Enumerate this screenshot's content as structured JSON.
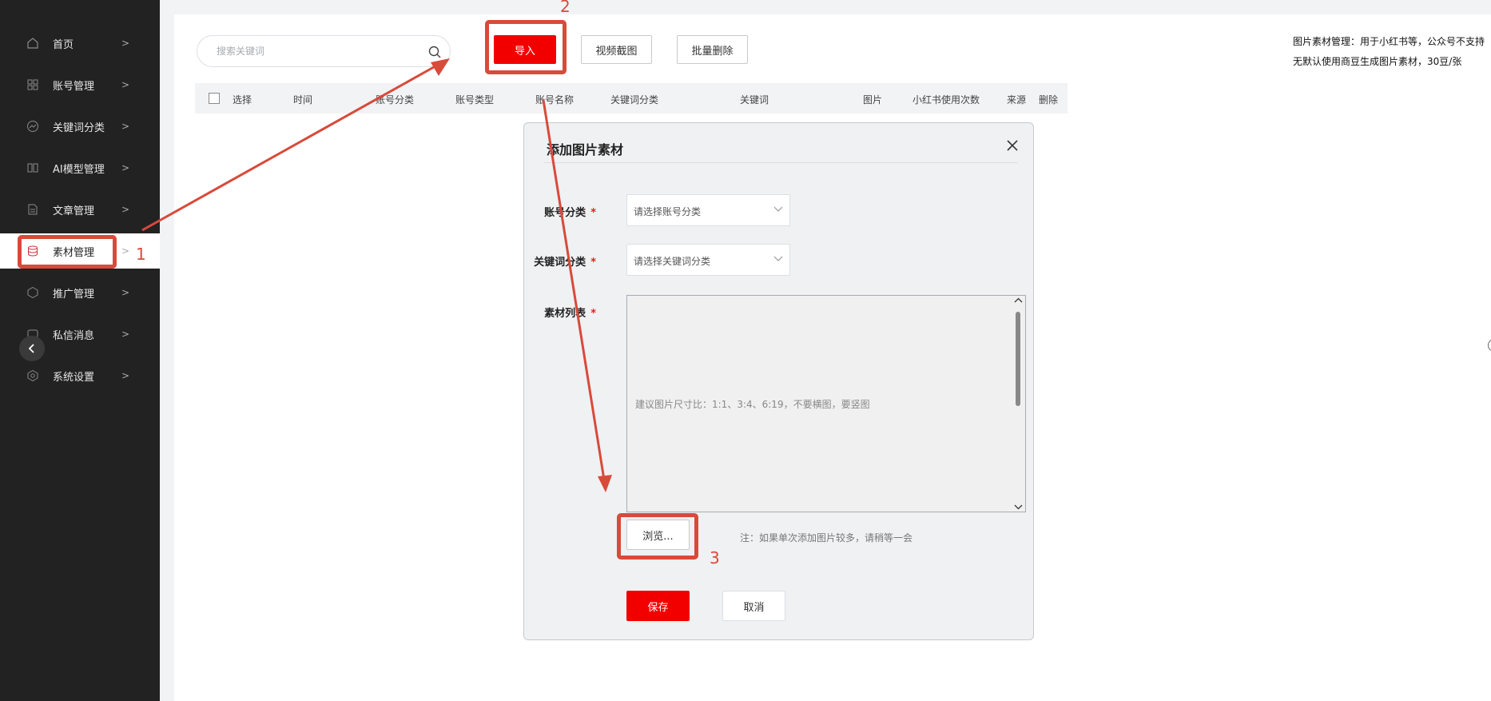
{
  "sidebar": {
    "items": [
      {
        "label": "首页",
        "icon": "home-icon"
      },
      {
        "label": "账号管理",
        "icon": "grid-icon"
      },
      {
        "label": "关键词分类",
        "icon": "trend-icon"
      },
      {
        "label": "AI模型管理",
        "icon": "book-icon"
      },
      {
        "label": "文章管理",
        "icon": "document-icon"
      },
      {
        "label": "素材管理",
        "icon": "database-icon",
        "active": true
      },
      {
        "label": "推广管理",
        "icon": "hexagon-icon"
      },
      {
        "label": "私信消息",
        "icon": "message-icon"
      },
      {
        "label": "系统设置",
        "icon": "gear-icon"
      }
    ]
  },
  "toolbar": {
    "search_placeholder": "搜索关键词",
    "import_label": "导入",
    "video_capture_label": "视频截图",
    "batch_delete_label": "批量删除"
  },
  "notes": {
    "line1": "图片素材管理：用于小红书等，公众号不支持",
    "line2": "无默认使用商豆生成图片素材，30豆/张"
  },
  "table": {
    "columns": [
      "选择",
      "时间",
      "账号分类",
      "账号类型",
      "账号名称",
      "关键词分类",
      "关键词",
      "图片",
      "小红书使用次数",
      "来源",
      "删除"
    ]
  },
  "dialog": {
    "title": "添加图片素材",
    "account_category_label": "账号分类",
    "account_category_placeholder": "请选择账号分类",
    "keyword_category_label": "关键词分类",
    "keyword_category_placeholder": "请选择关键词分类",
    "material_list_label": "素材列表",
    "material_list_placeholder": "建议图片尺寸比：1:1、3:4、6:19，不要横图，要竖图",
    "browse_label": "浏览...",
    "browse_note": "注：如果单次添加图片较多，请稍等一会",
    "save_label": "保存",
    "cancel_label": "取消",
    "required_mark": "*"
  },
  "annotations": {
    "step1": "1",
    "step2": "2",
    "step3": "3",
    "color": "#d84a3a"
  }
}
